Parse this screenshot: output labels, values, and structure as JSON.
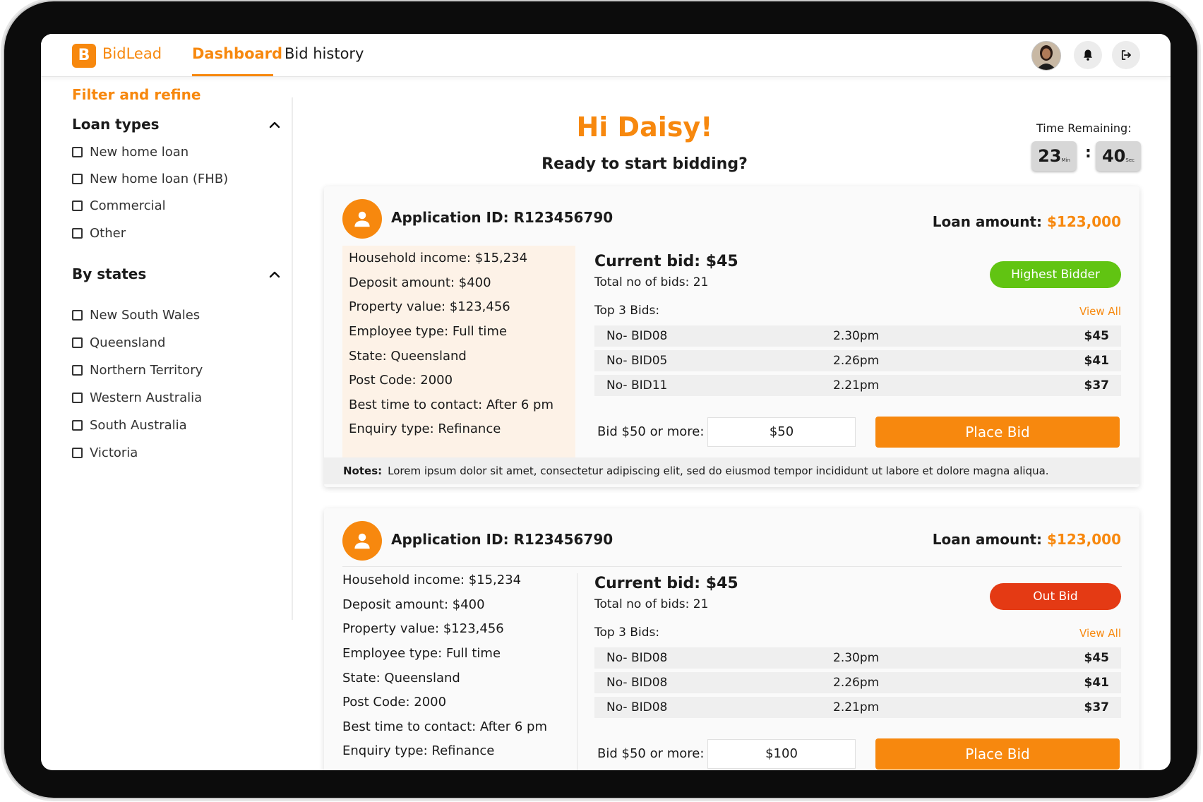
{
  "header": {
    "logo_letter": "B",
    "brand": "BidLead",
    "nav": [
      {
        "label": "Dashboard",
        "active": true
      },
      {
        "label": "Bid history",
        "active": false
      }
    ],
    "icons": [
      "avatar",
      "bell-icon",
      "logout-icon"
    ]
  },
  "sidebar": {
    "title": "Filter and refine",
    "loan_types": {
      "title": "Loan types",
      "options": [
        "New home loan",
        "New home loan (FHB)",
        "Commercial",
        "Other"
      ]
    },
    "states": {
      "title": "By states",
      "options": [
        "New South Wales",
        "Queensland",
        "Northern Territory",
        "Western Australia",
        "South Australia",
        "Victoria"
      ]
    }
  },
  "main": {
    "greeting": "Hi Daisy!",
    "subtitle": "Ready to start bidding?",
    "timer": {
      "label": "Time Remaining:",
      "minutes": "23",
      "minutes_unit": "Min",
      "seconds": "40",
      "seconds_unit": "Sec",
      "separator": ":"
    }
  },
  "cards": [
    {
      "application_id": "Application ID: R123456790",
      "loan_label": "Loan amount: ",
      "loan_value": "$123,000",
      "details": [
        "Household income: $15,234",
        "Deposit amount: $400",
        "Property value: $123,456",
        "Employee type: Full time",
        "State: Queensland",
        "Post Code: 2000",
        "Best time to contact: After 6 pm",
        "Enquiry type: Refinance"
      ],
      "current_bid": "Current bid: $45",
      "total_bids": "Total no of bids: 21",
      "status": "Highest Bidder",
      "status_color": "#61c412",
      "top3_label": "Top 3 Bids:",
      "view_all": "View All",
      "bids": [
        {
          "no": "No- BID08",
          "time": "2.30pm",
          "amount": "$45"
        },
        {
          "no": "No- BID05",
          "time": "2.26pm",
          "amount": "$41"
        },
        {
          "no": "No- BID11",
          "time": "2.21pm",
          "amount": "$37"
        }
      ],
      "bid_min_label": "Bid $50 or more:",
      "bid_input_value": "$50",
      "place_bid": "Place Bid",
      "notes_label": "Notes:",
      "notes_text": "Lorem ipsum dolor sit amet, consectetur adipiscing elit, sed do eiusmod tempor incididunt ut labore et dolore magna aliqua."
    },
    {
      "application_id": "Application ID: R123456790",
      "loan_label": "Loan amount: ",
      "loan_value": "$123,000",
      "details": [
        "Household income: $15,234",
        "Deposit amount: $400",
        "Property value: $123,456",
        "Employee type: Full time",
        "State: Queensland",
        "Post Code: 2000",
        "Best time to contact: After 6 pm",
        "Enquiry type: Refinance"
      ],
      "current_bid": "Current bid: $45",
      "total_bids": "Total no of bids: 21",
      "status": "Out Bid",
      "status_color": "#e43a14",
      "top3_label": "Top 3 Bids:",
      "view_all": "View All",
      "bids": [
        {
          "no": "No- BID08",
          "time": "2.30pm",
          "amount": "$45"
        },
        {
          "no": "No- BID08",
          "time": "2.26pm",
          "amount": "$41"
        },
        {
          "no": "No- BID08",
          "time": "2.21pm",
          "amount": "$37"
        }
      ],
      "bid_min_label": "Bid $50 or more:",
      "bid_input_value": "$100",
      "place_bid": "Place Bid"
    }
  ],
  "colors": {
    "accent": "#f7880e",
    "highest_bidder": "#61c412",
    "out_bid": "#e43a14",
    "highlight_bg": "#fdf2e7"
  }
}
